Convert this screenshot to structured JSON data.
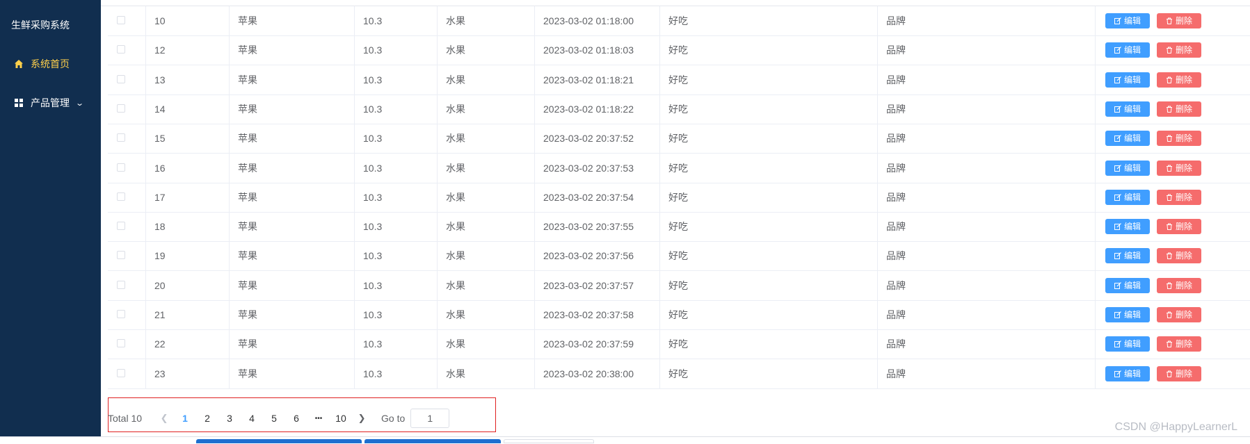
{
  "sidebar": {
    "brand": "生鲜采购系统",
    "items": [
      {
        "label": "系统首页",
        "icon": "home-icon",
        "active": true
      },
      {
        "label": "产品管理",
        "icon": "grid-icon",
        "active": false
      }
    ]
  },
  "table": {
    "rows": [
      {
        "id": "10",
        "name": "苹果",
        "price": "10.3",
        "category": "水果",
        "time": "2023-03-02 01:18:00",
        "desc": "好吃",
        "brand": "品牌"
      },
      {
        "id": "12",
        "name": "苹果",
        "price": "10.3",
        "category": "水果",
        "time": "2023-03-02 01:18:03",
        "desc": "好吃",
        "brand": "品牌"
      },
      {
        "id": "13",
        "name": "苹果",
        "price": "10.3",
        "category": "水果",
        "time": "2023-03-02 01:18:21",
        "desc": "好吃",
        "brand": "品牌"
      },
      {
        "id": "14",
        "name": "苹果",
        "price": "10.3",
        "category": "水果",
        "time": "2023-03-02 01:18:22",
        "desc": "好吃",
        "brand": "品牌"
      },
      {
        "id": "15",
        "name": "苹果",
        "price": "10.3",
        "category": "水果",
        "time": "2023-03-02 20:37:52",
        "desc": "好吃",
        "brand": "品牌"
      },
      {
        "id": "16",
        "name": "苹果",
        "price": "10.3",
        "category": "水果",
        "time": "2023-03-02 20:37:53",
        "desc": "好吃",
        "brand": "品牌"
      },
      {
        "id": "17",
        "name": "苹果",
        "price": "10.3",
        "category": "水果",
        "time": "2023-03-02 20:37:54",
        "desc": "好吃",
        "brand": "品牌"
      },
      {
        "id": "18",
        "name": "苹果",
        "price": "10.3",
        "category": "水果",
        "time": "2023-03-02 20:37:55",
        "desc": "好吃",
        "brand": "品牌"
      },
      {
        "id": "19",
        "name": "苹果",
        "price": "10.3",
        "category": "水果",
        "time": "2023-03-02 20:37:56",
        "desc": "好吃",
        "brand": "品牌"
      },
      {
        "id": "20",
        "name": "苹果",
        "price": "10.3",
        "category": "水果",
        "time": "2023-03-02 20:37:57",
        "desc": "好吃",
        "brand": "品牌"
      },
      {
        "id": "21",
        "name": "苹果",
        "price": "10.3",
        "category": "水果",
        "time": "2023-03-02 20:37:58",
        "desc": "好吃",
        "brand": "品牌"
      },
      {
        "id": "22",
        "name": "苹果",
        "price": "10.3",
        "category": "水果",
        "time": "2023-03-02 20:37:59",
        "desc": "好吃",
        "brand": "品牌"
      },
      {
        "id": "23",
        "name": "苹果",
        "price": "10.3",
        "category": "水果",
        "time": "2023-03-02 20:38:00",
        "desc": "好吃",
        "brand": "品牌"
      }
    ],
    "edit_label": "编辑",
    "delete_label": "删除"
  },
  "pagination": {
    "total_label": "Total 10",
    "pages": [
      "1",
      "2",
      "3",
      "4",
      "5",
      "6"
    ],
    "ellipsis": "•••",
    "last_page": "10",
    "current": "1",
    "goto_label": "Go to",
    "goto_value": "1"
  },
  "watermark": "CSDN @HappyLearnerL",
  "colors": {
    "sidebar_bg": "#112e4f",
    "active_menu": "#ffd04b",
    "primary": "#409eff",
    "danger": "#f56c6c"
  }
}
